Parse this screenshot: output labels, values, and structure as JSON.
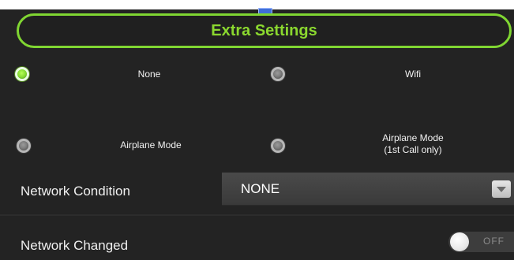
{
  "header": {
    "title": "Extra Settings"
  },
  "options": [
    {
      "label": "None",
      "selected": true
    },
    {
      "label": "Wifi",
      "selected": false
    },
    {
      "label": "Airplane Mode",
      "selected": false
    },
    {
      "label": "Airplane Mode\n(1st Call only)",
      "selected": false
    }
  ],
  "network_condition": {
    "label": "Network Condition",
    "value": "NONE"
  },
  "network_changed": {
    "label": "Network Changed",
    "toggle_text": "OFF",
    "enabled": false
  },
  "colors": {
    "accent": "#80d632",
    "background": "#232323"
  },
  "icons": {
    "dropdown": "chevron-down-icon"
  }
}
